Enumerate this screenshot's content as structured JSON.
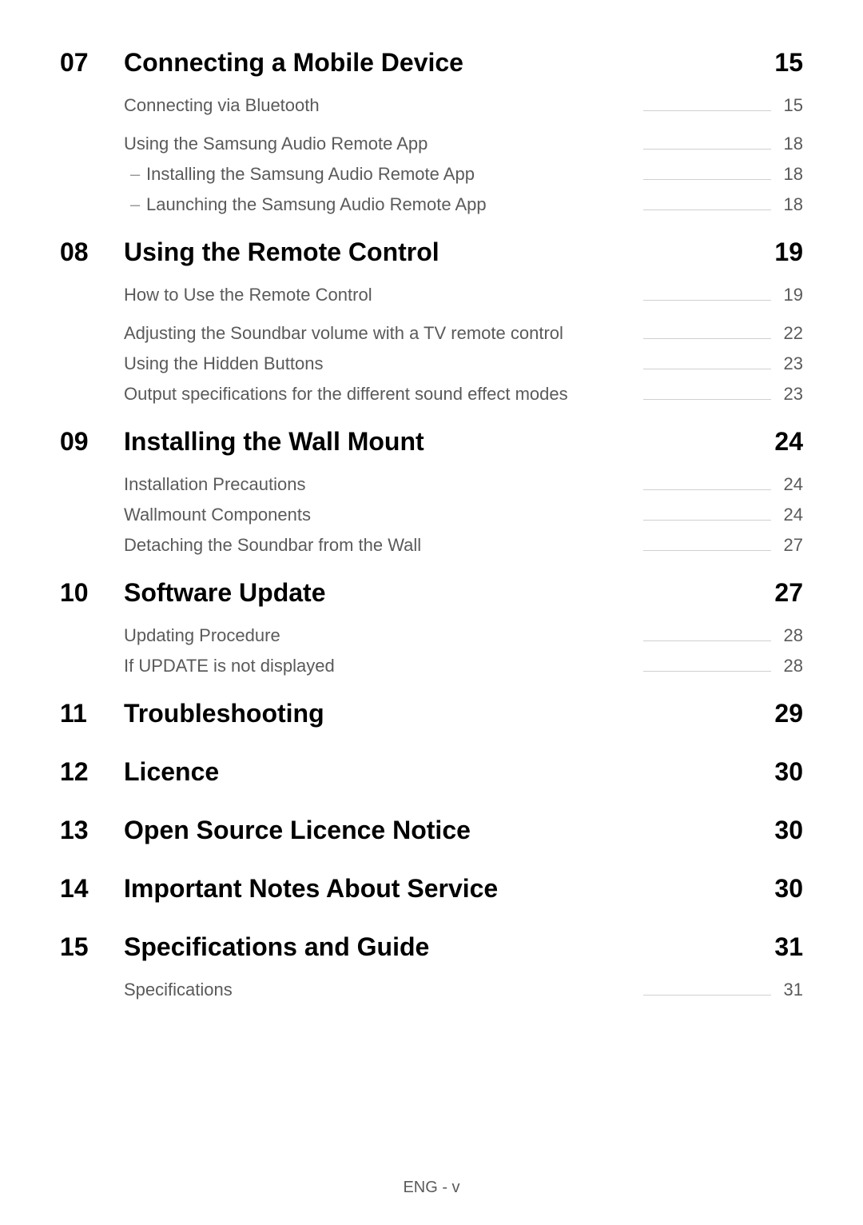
{
  "sections": [
    {
      "num": "07",
      "title": "Connecting a Mobile Device",
      "page": "15",
      "items": [
        {
          "label": "Connecting via Bluetooth",
          "page": "15",
          "level": 0,
          "gapAfter": true
        },
        {
          "label": "Using the Samsung Audio Remote App",
          "page": "18",
          "level": 0
        },
        {
          "label": "Installing the Samsung Audio Remote App",
          "page": "18",
          "level": 1
        },
        {
          "label": "Launching the Samsung Audio Remote App",
          "page": "18",
          "level": 1
        }
      ]
    },
    {
      "num": "08",
      "title": "Using the Remote Control",
      "page": "19",
      "items": [
        {
          "label": "How to Use the Remote Control",
          "page": "19",
          "level": 0,
          "gapAfter": true
        },
        {
          "label": "Adjusting the Soundbar volume with a TV remote control",
          "page": "22",
          "level": 0
        },
        {
          "label": "Using the Hidden Buttons",
          "page": "23",
          "level": 0
        },
        {
          "label": "Output specifications for the different sound effect modes",
          "page": "23",
          "level": 0
        }
      ]
    },
    {
      "num": "09",
      "title": "Installing the Wall Mount",
      "page": "24",
      "items": [
        {
          "label": "Installation Precautions",
          "page": "24",
          "level": 0
        },
        {
          "label": "Wallmount Components",
          "page": "24",
          "level": 0
        },
        {
          "label": "Detaching the Soundbar from the Wall",
          "page": "27",
          "level": 0
        }
      ]
    },
    {
      "num": "10",
      "title": "Software Update",
      "page": "27",
      "items": [
        {
          "label": "Updating Procedure",
          "page": "28",
          "level": 0
        },
        {
          "label": "If UPDATE is not displayed",
          "page": "28",
          "level": 0
        }
      ]
    },
    {
      "num": "11",
      "title": "Troubleshooting",
      "page": "29",
      "items": []
    },
    {
      "num": "12",
      "title": "Licence",
      "page": "30",
      "items": []
    },
    {
      "num": "13",
      "title": "Open Source Licence Notice",
      "page": "30",
      "items": []
    },
    {
      "num": "14",
      "title": "Important Notes About Service",
      "page": "30",
      "items": []
    },
    {
      "num": "15",
      "title": "Specifications and Guide",
      "page": "31",
      "items": [
        {
          "label": "Specifications",
          "page": "31",
          "level": 0
        }
      ]
    }
  ],
  "footer": "ENG - v"
}
